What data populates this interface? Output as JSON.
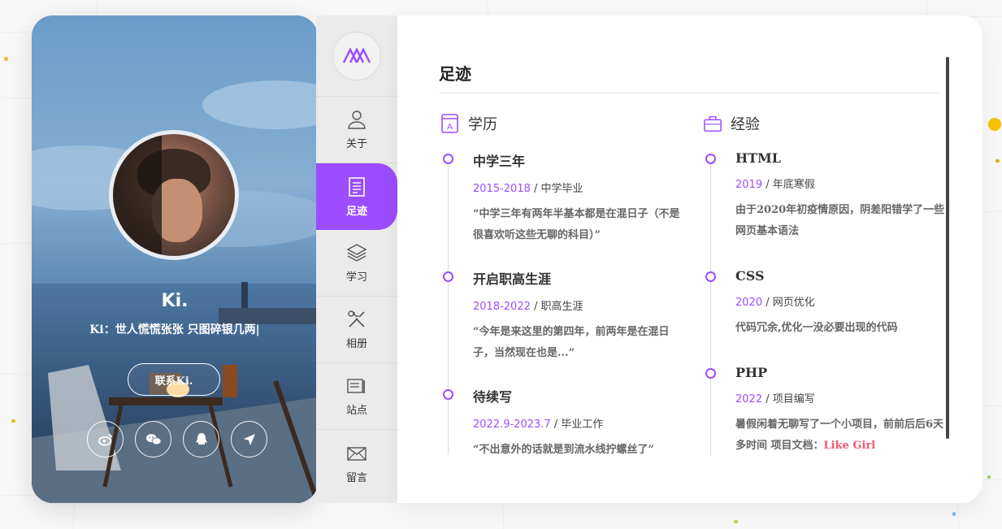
{
  "profile": {
    "name": "Ki.",
    "motto": "Ki：世人慌慌张张 只图碎银几两|",
    "contact_label": "联系Ki.",
    "socials": [
      "weibo-icon",
      "wechat-icon",
      "qq-icon",
      "send-icon"
    ]
  },
  "nav": {
    "items": [
      {
        "label": "关于",
        "icon": "user-icon"
      },
      {
        "label": "足迹",
        "icon": "document-icon",
        "active": true
      },
      {
        "label": "学习",
        "icon": "layers-icon"
      },
      {
        "label": "相册",
        "icon": "tools-icon"
      },
      {
        "label": "站点",
        "icon": "sites-icon"
      },
      {
        "label": "留言",
        "icon": "mail-icon"
      }
    ]
  },
  "main": {
    "title": "足迹",
    "education": {
      "heading": "学历",
      "entries": [
        {
          "title": "中学三年",
          "years": "2015-2018",
          "tag": "中学毕业",
          "desc": "“中学三年有两年半基本都是在混日子（不是很喜欢听这些无聊的科目）”"
        },
        {
          "title": "开启职高生涯",
          "years": "2018-2022",
          "tag": "职高生涯",
          "desc": "“今年是来这里的第四年，前两年是在混日子，当然现在也是...”"
        },
        {
          "title": "待续写",
          "years": "2022.9-2023.7",
          "tag": "毕业工作",
          "desc": "“不出意外的话就是到流水线拧螺丝了”"
        }
      ]
    },
    "experience": {
      "heading": "经验",
      "entries": [
        {
          "title": "HTML",
          "years": "2019",
          "tag": "年底寒假",
          "desc": "由于2020年初疫情原因，阴差阳错学了一些网页基本语法"
        },
        {
          "title": "CSS",
          "years": "2020",
          "tag": "网页优化",
          "desc": "代码冗余,优化一没必要出现的代码"
        },
        {
          "title": "PHP",
          "years": "2022",
          "tag": "项目编写",
          "desc": "暑假闲着无聊写了一个小项目，前前后后6天多时间 项目文档：",
          "link": "Like Girl"
        }
      ]
    }
  },
  "colors": {
    "accent": "#9b4dff",
    "link": "#f05a6e"
  }
}
